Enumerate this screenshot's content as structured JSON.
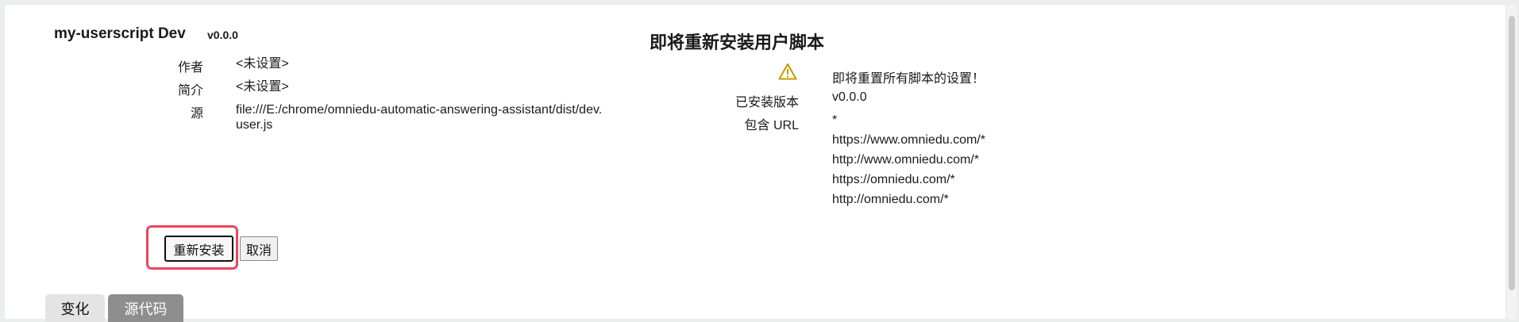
{
  "script": {
    "name": "my-userscript Dev",
    "version": "v0.0.0"
  },
  "left_fields": [
    {
      "label": "作者",
      "value": "<未设置>"
    },
    {
      "label": "简介",
      "value": "<未设置>"
    },
    {
      "label": "源",
      "value": "file:///E:/chrome/omniedu-automatic-answering-assistant/dist/dev.user.js"
    }
  ],
  "right": {
    "title": "即将重新安装用户脚本",
    "warning_text": "即将重置所有脚本的设置！",
    "installed_version_label": "已安装版本",
    "installed_version": "v0.0.0",
    "includes_label": "包含 URL",
    "includes": [
      "*",
      "https://www.omniedu.com/*",
      "http://www.omniedu.com/*",
      "https://omniedu.com/*",
      "http://omniedu.com/*"
    ]
  },
  "buttons": {
    "reinstall": "重新安装",
    "cancel": "取消"
  },
  "tabs": [
    {
      "label": "变化",
      "active": false
    },
    {
      "label": "源代码",
      "active": true
    }
  ],
  "colors": {
    "highlight": "#e8475f",
    "warning_icon": "#c89b00",
    "active_tab": "#8e8e8e"
  },
  "icons": {
    "warning": "warning-triangle-icon"
  }
}
